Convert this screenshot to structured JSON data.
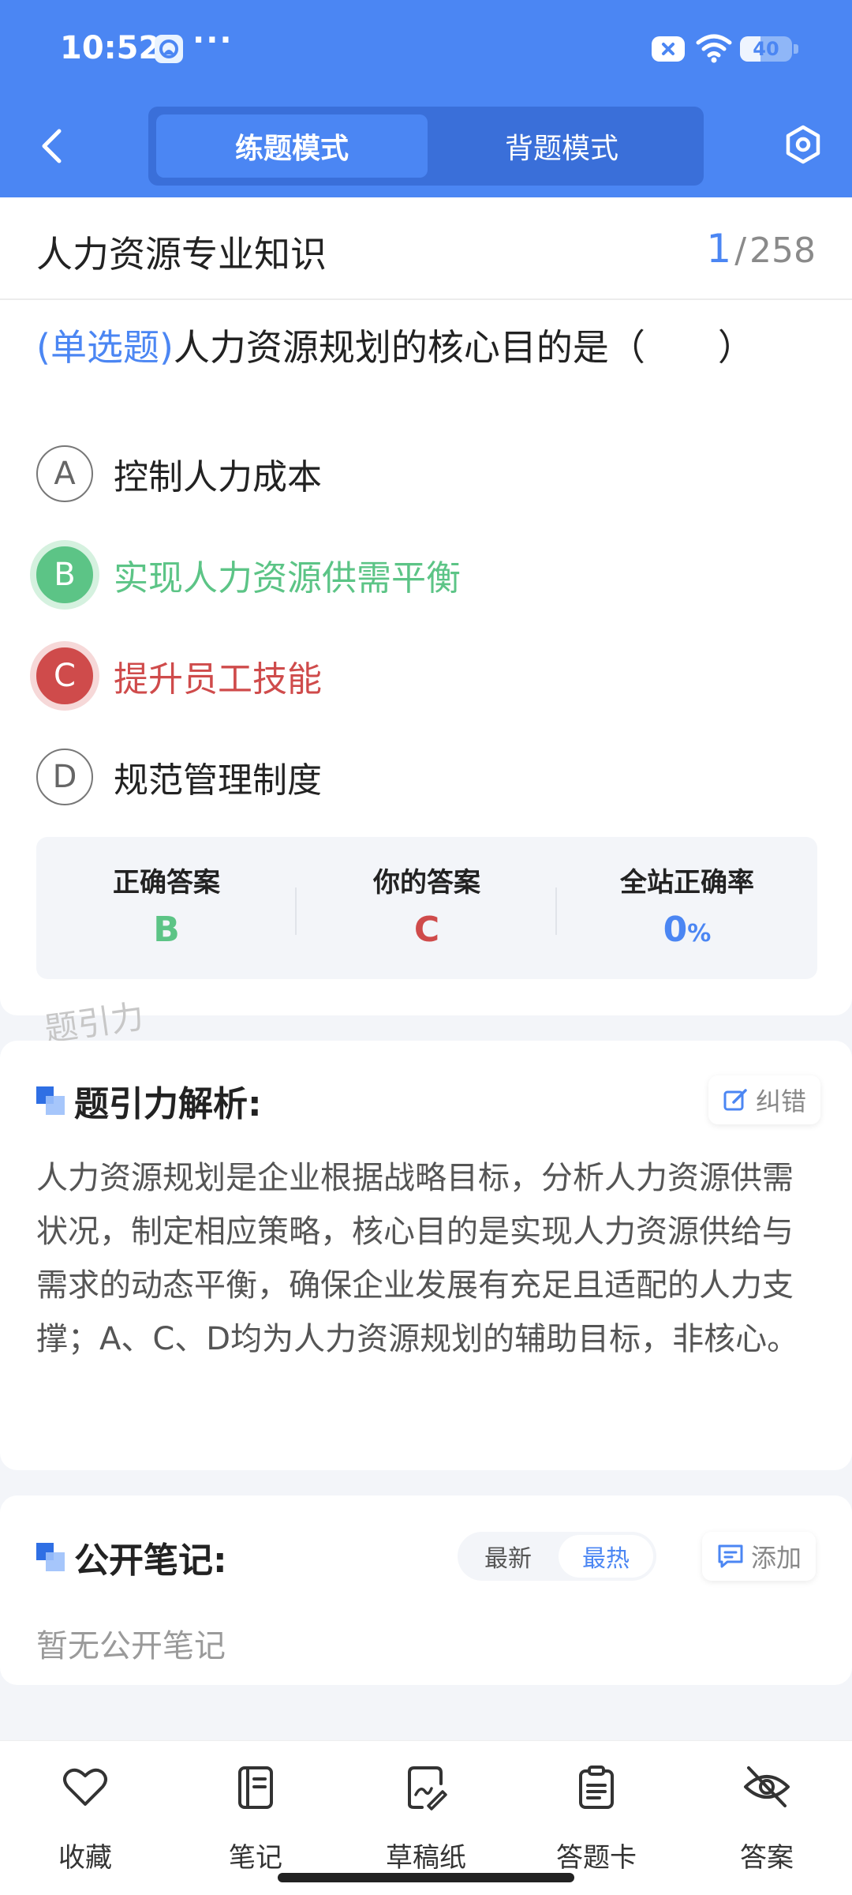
{
  "status_bar": {
    "time": "10:52",
    "more": "···",
    "battery_level": "40",
    "battery_fraction": 0.4
  },
  "header": {
    "back_icon": "chevron-left-icon",
    "mode_practice": "练题模式",
    "mode_memorize": "背题模式",
    "settings_icon": "hexagon-settings-icon"
  },
  "question": {
    "subject": "人力资源专业知识",
    "current": "1",
    "separator": "/",
    "total": "258",
    "type": "(单选题)",
    "text": "人力资源规划的核心目的是（　　）",
    "options": [
      {
        "letter": "A",
        "label": "控制人力成本",
        "state": "normal"
      },
      {
        "letter": "B",
        "label": "实现人力资源供需平衡",
        "state": "correct"
      },
      {
        "letter": "C",
        "label": "提升员工技能",
        "state": "wrong"
      },
      {
        "letter": "D",
        "label": "规范管理制度",
        "state": "normal"
      }
    ]
  },
  "answer_summary": {
    "correct_label": "正确答案",
    "correct_value": "B",
    "yours_label": "你的答案",
    "yours_value": "C",
    "rate_label": "全站正确率",
    "rate_value": "0",
    "rate_unit": "%"
  },
  "watermark": "题引力",
  "analysis": {
    "title": "题引力解析:",
    "report_label": "纠错",
    "text": "人力资源规划是企业根据战略目标，分析人力资源供需状况，制定相应策略，核心目的是实现人力资源供给与需求的动态平衡，确保企业发展有充足且适配的人力支撑；A、C、D均为人力资源规划的辅助目标，非核心。"
  },
  "notes": {
    "title": "公开笔记:",
    "sort_latest": "最新",
    "sort_hot": "最热",
    "add_label": "添加",
    "empty_text": "暂无公开笔记"
  },
  "bottom_nav": {
    "favorite": "收藏",
    "note": "笔记",
    "draft": "草稿纸",
    "answer_card": "答题卡",
    "answer": "答案"
  },
  "colors": {
    "brand": "#4b86f3",
    "correct": "#5cc486",
    "wrong": "#cf4b4b"
  }
}
